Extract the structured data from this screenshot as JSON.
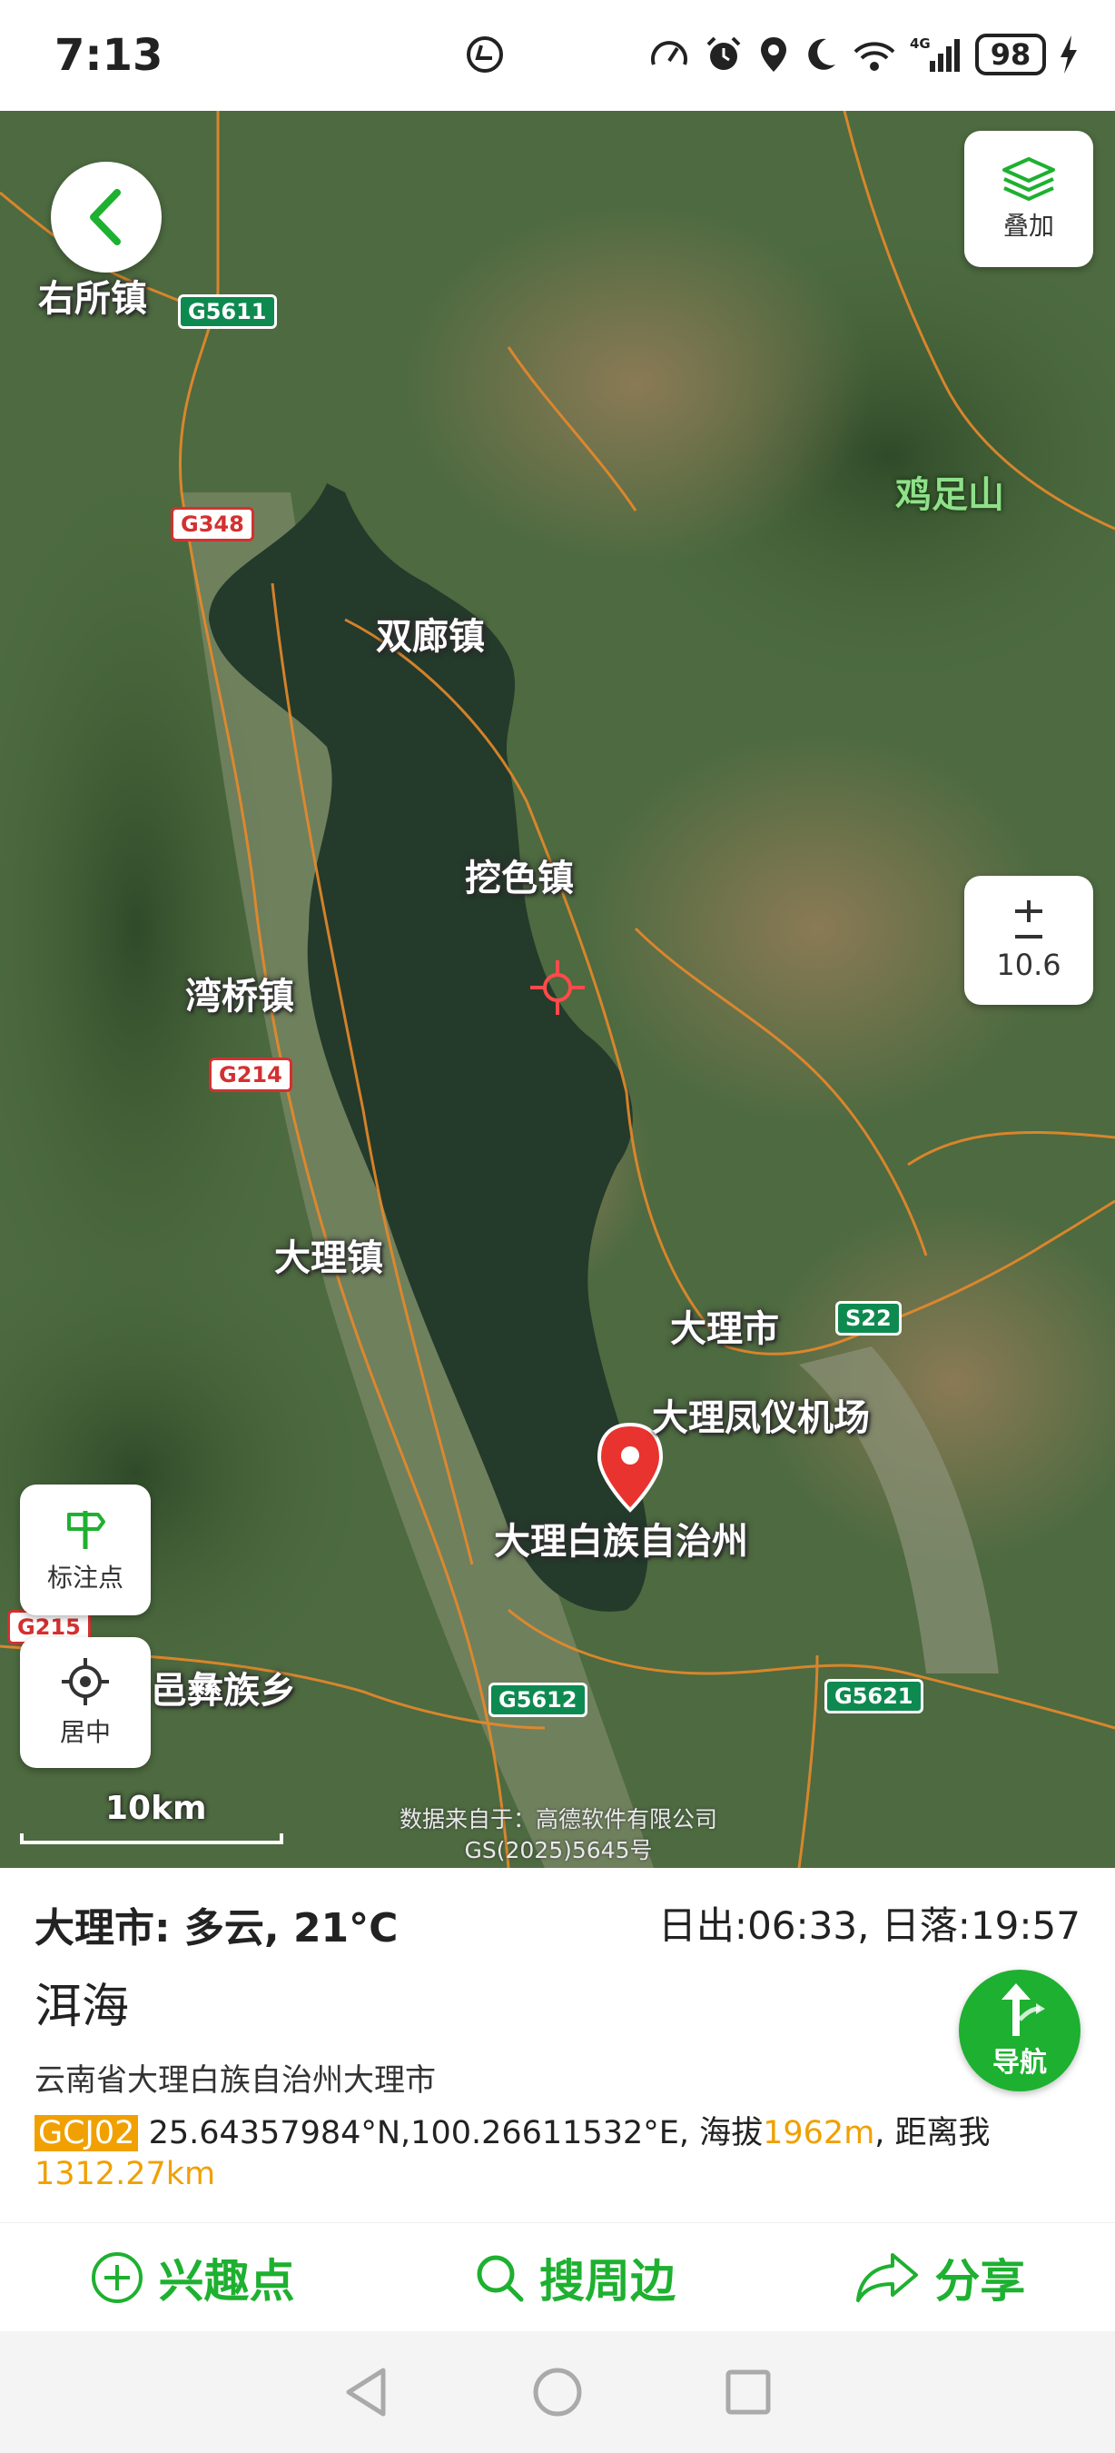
{
  "status_bar": {
    "time": "7:13",
    "battery": "98"
  },
  "map": {
    "overlay_label": "叠加",
    "zoom_level": "10.6",
    "mark_point_label": "标注点",
    "center_label": "居中",
    "scale_label": "10km",
    "attribution": [
      "数据来自于：高德软件有限公司",
      "GS(2025)5645号"
    ],
    "places": {
      "yousuo": "右所镇",
      "jizushan": "鸡足山",
      "shuanglang": "双廊镇",
      "wase": "挖色镇",
      "wanqiao": "湾桥镇",
      "dali_town": "大理镇",
      "dali_city": "大理市",
      "airport": "大理凤仪机场",
      "prefecture": "大理白族自治州",
      "yi_township": "邑彝族乡"
    },
    "roads": {
      "g5611": "G5611",
      "g348": "G348",
      "g214": "G214",
      "s22": "S22",
      "g215": "G215",
      "g5612": "G5612",
      "g5621": "G5621"
    }
  },
  "info": {
    "weather": "大理市: 多云, 21°C",
    "sun_times": "日出:06:33, 日落:19:57",
    "poi_name": "洱海",
    "address": "云南省大理白族自治州大理市",
    "coord_system": "GCJ02",
    "coordinates": "25.64357984°N,100.26611532°E, 海拔",
    "altitude": "1962m",
    "distance_label": ", 距离我",
    "distance": "1312.27km",
    "nav_label": "导航"
  },
  "actions": {
    "poi": "兴趣点",
    "nearby": "搜周边",
    "share": "分享"
  },
  "colors": {
    "accent": "#1eb030",
    "highlight": "#f0a000",
    "marker": "#e8332f"
  }
}
